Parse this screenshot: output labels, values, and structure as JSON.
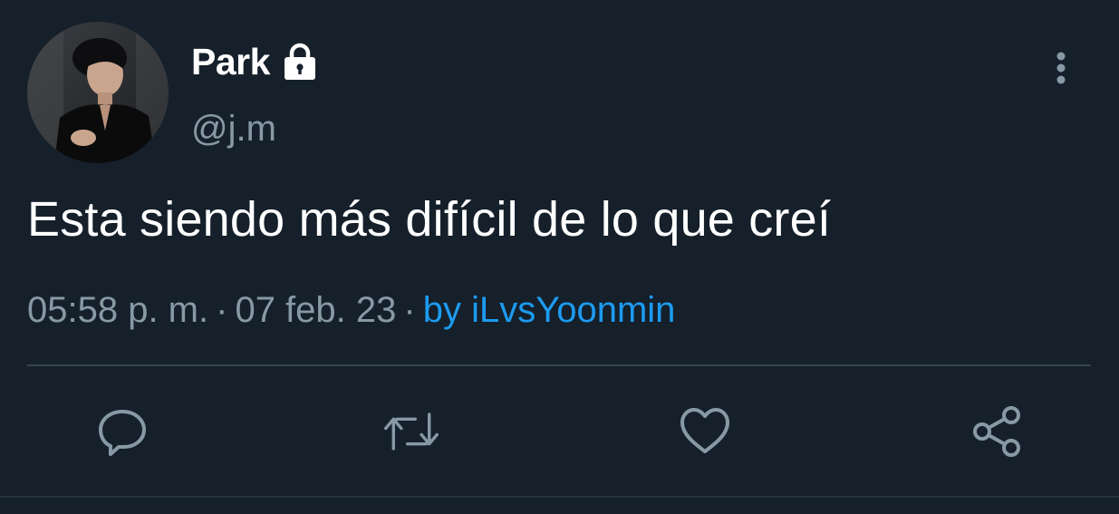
{
  "tweet": {
    "display_name": "Park",
    "handle": "@j.m",
    "text": "Esta siendo más difícil de lo que creí",
    "time": "05:58 p. m.",
    "date": "07 feb. 23",
    "separator": "·",
    "source": "by iLvsYoonmin"
  },
  "icons": {
    "verified_lock": "lock-icon",
    "more": "more-vertical-icon",
    "reply": "reply-icon",
    "retweet": "retweet-icon",
    "like": "heart-icon",
    "share": "share-icon"
  },
  "colors": {
    "background": "#15202b",
    "text_primary": "#ffffff",
    "text_secondary": "#8899a6",
    "link": "#1d9bf0",
    "divider": "#38444d"
  }
}
